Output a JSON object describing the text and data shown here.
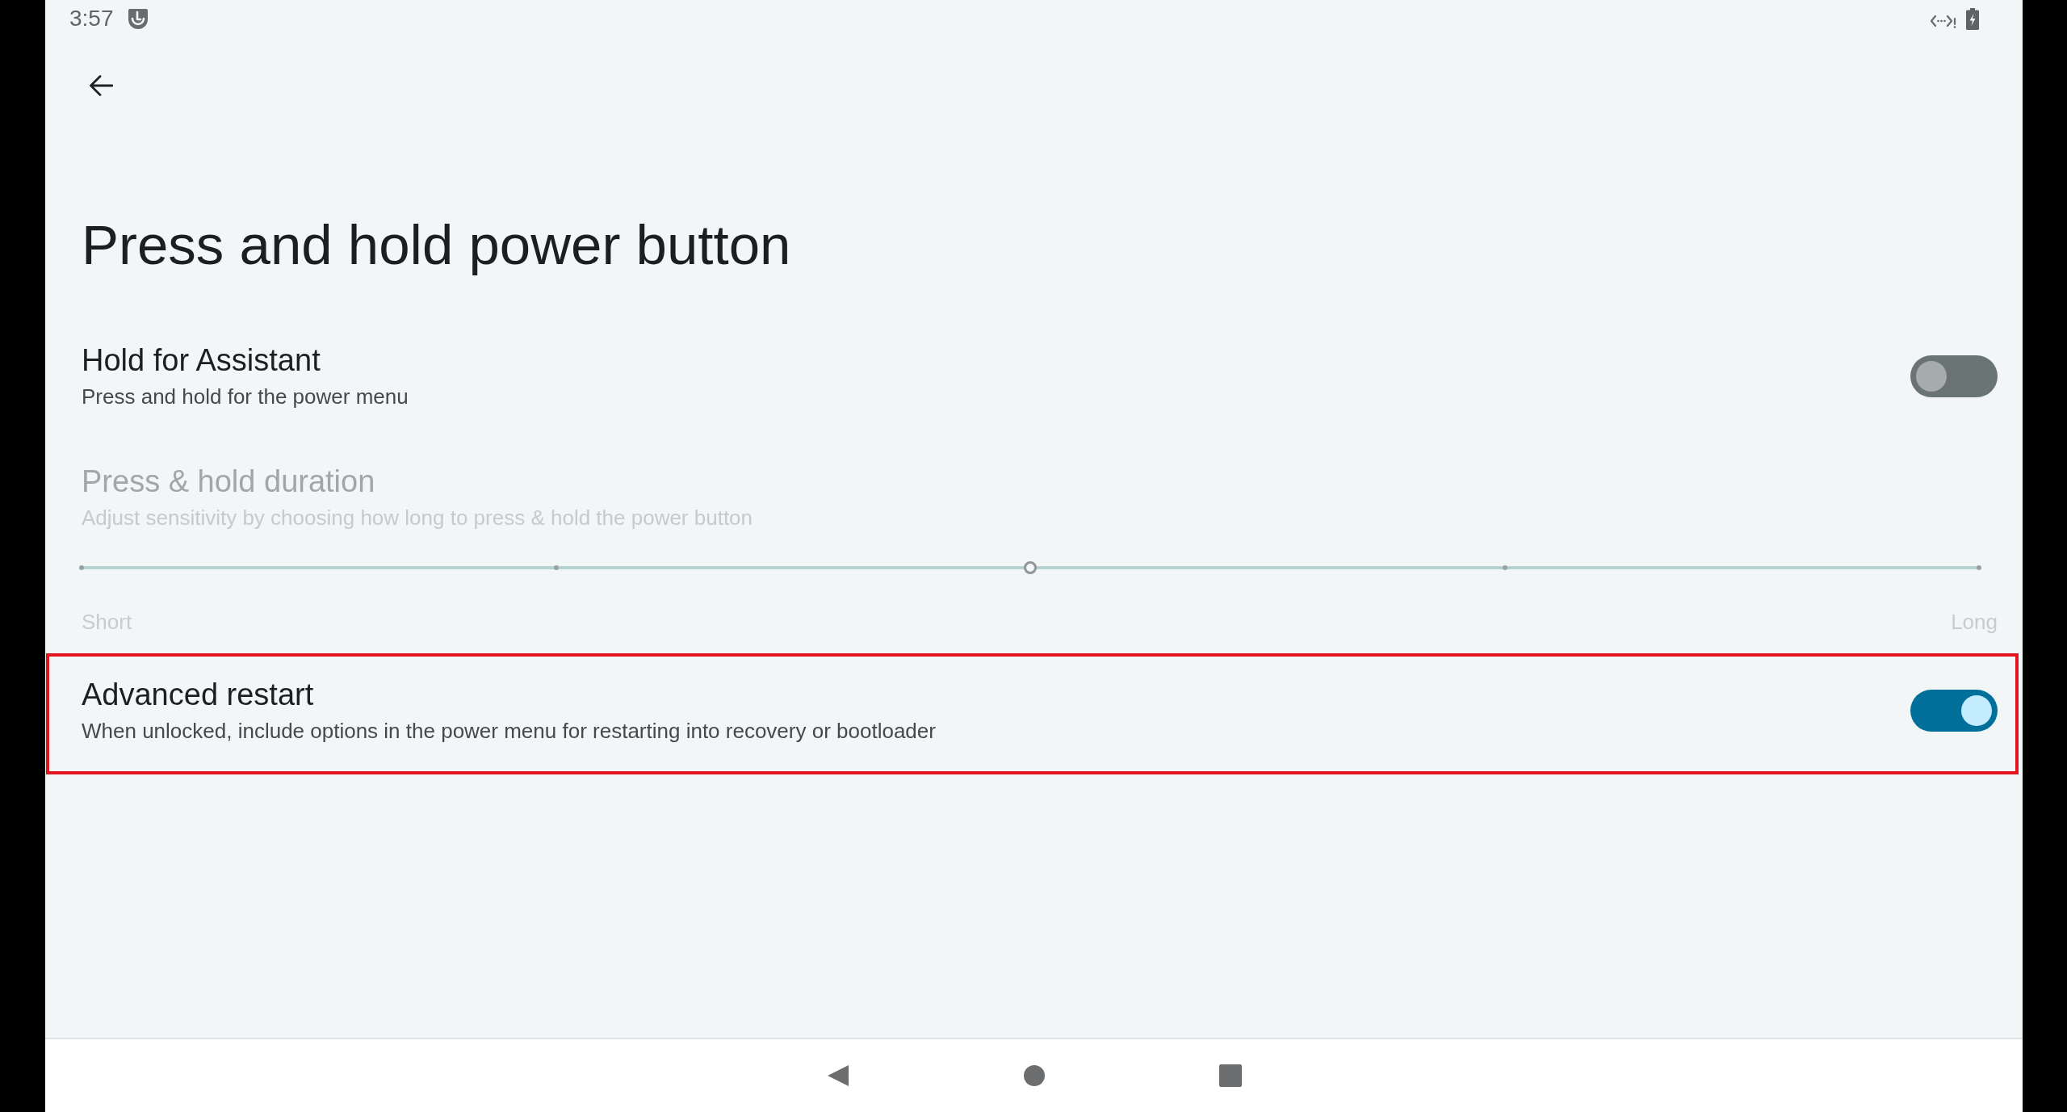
{
  "status_bar": {
    "time": "3:57"
  },
  "title": "Press and hold power button",
  "settings": [
    {
      "kind": "switch",
      "title": "Hold for Assistant",
      "summary": "Press and hold for the power menu",
      "on": false,
      "disabled": false,
      "highlighted": false
    },
    {
      "kind": "slider",
      "title": "Press & hold duration",
      "summary": "Adjust sensitivity by choosing how long to press & hold the power button",
      "level": 0.5,
      "min_label": "Short",
      "max_label": "Long",
      "disabled": true,
      "highlighted": false
    },
    {
      "kind": "switch",
      "title": "Advanced restart",
      "summary": "When unlocked, include options in the power menu for restarting into recovery or bootloader",
      "on": true,
      "disabled": false,
      "highlighted": true
    }
  ]
}
